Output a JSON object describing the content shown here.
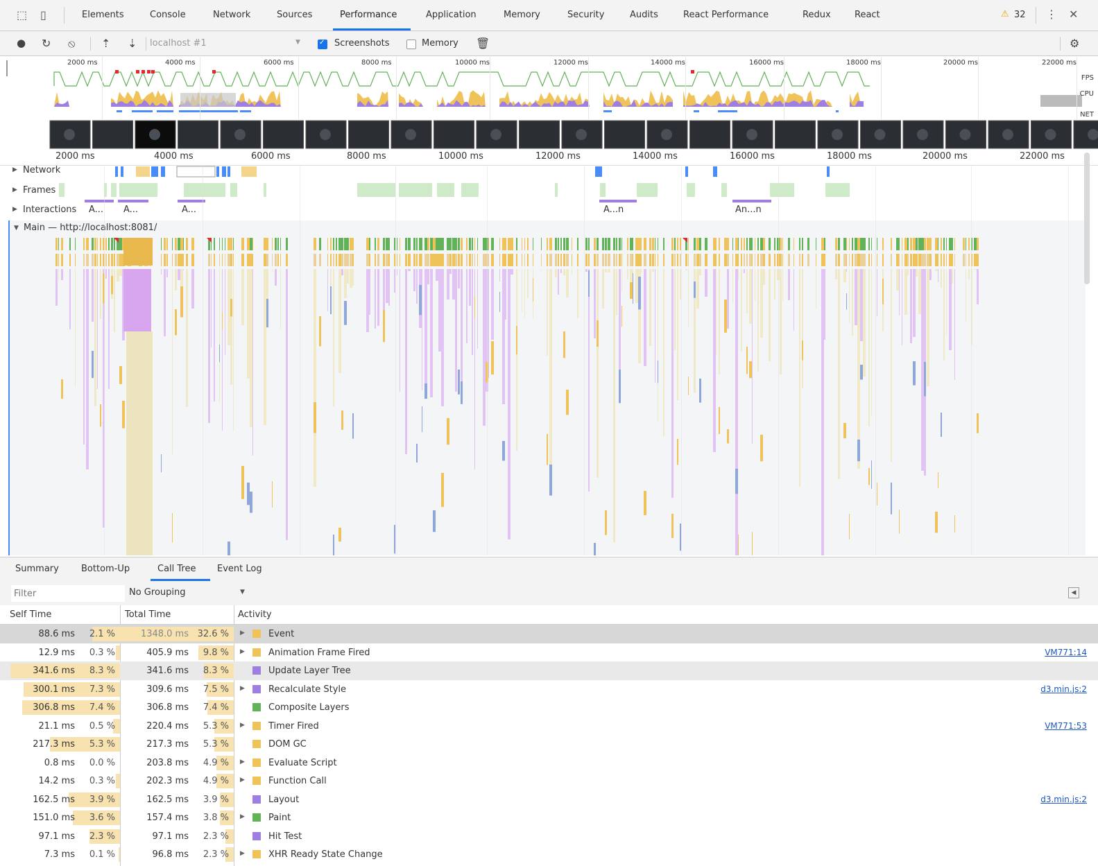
{
  "devtools_tabs": [
    "Elements",
    "Console",
    "Network",
    "Sources",
    "Performance",
    "Application",
    "Memory",
    "Security",
    "Audits",
    "React Performance",
    "Redux",
    "React"
  ],
  "active_tab": "Performance",
  "warning_count": "32",
  "toolbar": {
    "target": "localhost #1",
    "screenshots_label": "Screenshots",
    "screenshots_checked": true,
    "memory_label": "Memory",
    "memory_checked": false
  },
  "overview": {
    "ticks": [
      "2000 ms",
      "4000 ms",
      "6000 ms",
      "8000 ms",
      "10000 ms",
      "12000 ms",
      "14000 ms",
      "16000 ms",
      "18000 ms",
      "20000 ms",
      "22000 ms"
    ],
    "labels": {
      "fps": "FPS",
      "cpu": "CPU",
      "net": "NET"
    }
  },
  "ruler_ticks": [
    "2000 ms",
    "4000 ms",
    "6000 ms",
    "8000 ms",
    "10000 ms",
    "12000 ms",
    "14000 ms",
    "16000 ms",
    "18000 ms",
    "20000 ms",
    "22000 ms"
  ],
  "tracks": {
    "network": "Network",
    "frames": "Frames",
    "interactions": "Interactions",
    "main": "Main — http://localhost:8081/"
  },
  "interaction_labels": [
    "A...",
    "A...",
    "A...",
    "A...n",
    "An...n"
  ],
  "bottom_tabs": [
    "Summary",
    "Bottom-Up",
    "Call Tree",
    "Event Log"
  ],
  "active_bottom_tab": "Call Tree",
  "filter_placeholder": "Filter",
  "grouping": "No Grouping",
  "columns": {
    "self": "Self Time",
    "total": "Total Time",
    "activity": "Activity"
  },
  "colors": {
    "scripting": "#f0c25a",
    "rendering": "#9e7ee0",
    "painting": "#62b257",
    "accent": "#1a73e8"
  },
  "rows": [
    {
      "self": "88.6 ms",
      "self_pct": "2.1 %",
      "total": "1348.0 ms",
      "total_pct": "32.6 %",
      "activity": "Event",
      "color": "#f0c25a",
      "expand": true,
      "link": "",
      "state": "sel",
      "self_frac": 0.021,
      "total_frac": 0.326
    },
    {
      "self": "12.9 ms",
      "self_pct": "0.3 %",
      "total": "405.9 ms",
      "total_pct": "9.8 %",
      "activity": "Animation Frame Fired",
      "color": "#f0c25a",
      "expand": true,
      "link": "VM771:14",
      "state": "",
      "self_frac": 0.003,
      "total_frac": 0.098
    },
    {
      "self": "341.6 ms",
      "self_pct": "8.3 %",
      "total": "341.6 ms",
      "total_pct": "8.3 %",
      "activity": "Update Layer Tree",
      "color": "#9e7ee0",
      "expand": false,
      "link": "",
      "state": "alt",
      "self_frac": 0.083,
      "total_frac": 0.083
    },
    {
      "self": "300.1 ms",
      "self_pct": "7.3 %",
      "total": "309.6 ms",
      "total_pct": "7.5 %",
      "activity": "Recalculate Style",
      "color": "#9e7ee0",
      "expand": true,
      "link": "d3.min.js:2",
      "state": "",
      "self_frac": 0.073,
      "total_frac": 0.075
    },
    {
      "self": "306.8 ms",
      "self_pct": "7.4 %",
      "total": "306.8 ms",
      "total_pct": "7.4 %",
      "activity": "Composite Layers",
      "color": "#62b257",
      "expand": false,
      "link": "",
      "state": "",
      "self_frac": 0.074,
      "total_frac": 0.074
    },
    {
      "self": "21.1 ms",
      "self_pct": "0.5 %",
      "total": "220.4 ms",
      "total_pct": "5.3 %",
      "activity": "Timer Fired",
      "color": "#f0c25a",
      "expand": true,
      "link": "VM771:53",
      "state": "",
      "self_frac": 0.005,
      "total_frac": 0.053
    },
    {
      "self": "217.3 ms",
      "self_pct": "5.3 %",
      "total": "217.3 ms",
      "total_pct": "5.3 %",
      "activity": "DOM GC",
      "color": "#f0c25a",
      "expand": false,
      "link": "",
      "state": "",
      "self_frac": 0.053,
      "total_frac": 0.053
    },
    {
      "self": "0.8 ms",
      "self_pct": "0.0 %",
      "total": "203.8 ms",
      "total_pct": "4.9 %",
      "activity": "Evaluate Script",
      "color": "#f0c25a",
      "expand": true,
      "link": "",
      "state": "",
      "self_frac": 0.0,
      "total_frac": 0.049
    },
    {
      "self": "14.2 ms",
      "self_pct": "0.3 %",
      "total": "202.3 ms",
      "total_pct": "4.9 %",
      "activity": "Function Call",
      "color": "#f0c25a",
      "expand": true,
      "link": "",
      "state": "",
      "self_frac": 0.003,
      "total_frac": 0.049
    },
    {
      "self": "162.5 ms",
      "self_pct": "3.9 %",
      "total": "162.5 ms",
      "total_pct": "3.9 %",
      "activity": "Layout",
      "color": "#9e7ee0",
      "expand": false,
      "link": "d3.min.js:2",
      "state": "",
      "self_frac": 0.039,
      "total_frac": 0.039
    },
    {
      "self": "151.0 ms",
      "self_pct": "3.6 %",
      "total": "157.4 ms",
      "total_pct": "3.8 %",
      "activity": "Paint",
      "color": "#62b257",
      "expand": true,
      "link": "",
      "state": "",
      "self_frac": 0.036,
      "total_frac": 0.038
    },
    {
      "self": "97.1 ms",
      "self_pct": "2.3 %",
      "total": "97.1 ms",
      "total_pct": "2.3 %",
      "activity": "Hit Test",
      "color": "#9e7ee0",
      "expand": false,
      "link": "",
      "state": "",
      "self_frac": 0.023,
      "total_frac": 0.023
    },
    {
      "self": "7.3 ms",
      "self_pct": "0.1 %",
      "total": "96.8 ms",
      "total_pct": "2.3 %",
      "activity": "XHR Ready State Change",
      "color": "#f0c25a",
      "expand": true,
      "link": "",
      "state": "",
      "self_frac": 0.001,
      "total_frac": 0.023
    }
  ]
}
